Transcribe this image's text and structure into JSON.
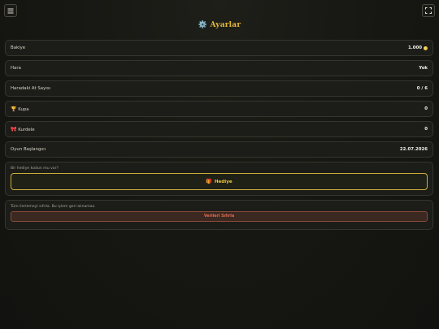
{
  "header": {
    "menu_icon": "menu-icon",
    "fullscreen_icon": "fullscreen-icon",
    "title_icon": "⚙️",
    "title": "Ayarlar"
  },
  "rows": [
    {
      "label": "Bakiye",
      "value": "1.000",
      "icon": "coin-icon"
    },
    {
      "label": "Hara",
      "value": "Yok"
    },
    {
      "label": "Haradaki At Sayısı",
      "value": "0 / 6"
    },
    {
      "label_icon": "🏆",
      "label": "Kupa",
      "value": "0"
    },
    {
      "label_icon": "🎀",
      "label": "Kurdele",
      "value": "0"
    },
    {
      "label": "Oyun Başlangıcı",
      "value": "22.07.2026"
    }
  ],
  "gift": {
    "hint": "Bir hediye kodun mu var?",
    "button_icon": "🎁",
    "button_label": "Hediye"
  },
  "reset": {
    "hint": "Tüm ilerlemeyi sıfırla. Bu işlem geri alınamaz.",
    "button_label": "Verileri Sıfırla"
  },
  "colors": {
    "accent": "#e3b93c",
    "danger": "#e06a52",
    "background": "#161612"
  }
}
